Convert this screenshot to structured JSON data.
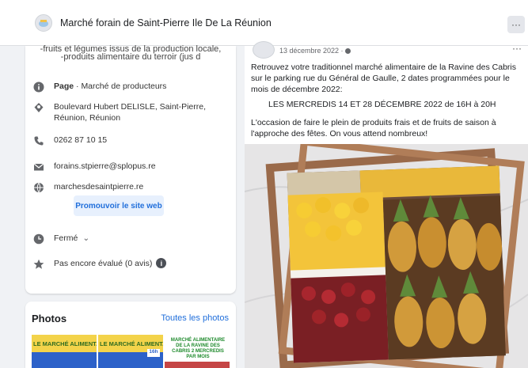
{
  "header": {
    "page_name": "Marché forain de Saint-Pierre Ile De La Réunion",
    "more_label": "···"
  },
  "intro": {
    "line1": "-fruits et légumes issus de la production locale,",
    "line2": "-produits alimentaire du terroir (jus d"
  },
  "details": {
    "category_prefix": "Page",
    "category": " · Marché de producteurs",
    "address": "Boulevard Hubert DELISLE, Saint-Pierre, Réunion, Réunion",
    "phone": "0262 87 10 15",
    "email": "forains.stpierre@splopus.re",
    "website": "marchesdesaintpierre.re",
    "promote_label": "Promouvoir le site web",
    "hours_status": "Fermé",
    "hours_caret": "⌄",
    "rating": "Pas encore évalué (0 avis)",
    "info_glyph": "i"
  },
  "photos": {
    "title": "Photos",
    "see_all": "Toutes les photos",
    "thumb1": "LE MARCHÉ ALIMENTAIRE",
    "thumb2": "LE MARCHÉ ALIMENTAIRE",
    "thumb_tag": "16h",
    "thumb3": "MARCHÉ ALIMENTAIRE DE LA RAVINE DES CABRIS 2 MERCREDIS PAR MOIS"
  },
  "post": {
    "date": "13 décembre 2022 · ",
    "dots": "···",
    "paragraph1": "Retrouvez votre traditionnel marché alimentaire de la Ravine des Cabris sur le parking rue du Général de Gaulle, 2 dates programmées pour le mois de décembre 2022:",
    "paragraph2": "LES MERCREDIS 14 ET 28 DÉCEMBRE 2022 de 16H à 20H",
    "paragraph3": "L'occasion de faire le plein de produits frais et de fruits de saison à l'approche des fêtes. On vous attend nombreux!"
  },
  "colors": {
    "link": "#216fdb",
    "closed": "#c03030",
    "card_bg": "#ffffff",
    "page_bg": "#f0f2f5"
  }
}
